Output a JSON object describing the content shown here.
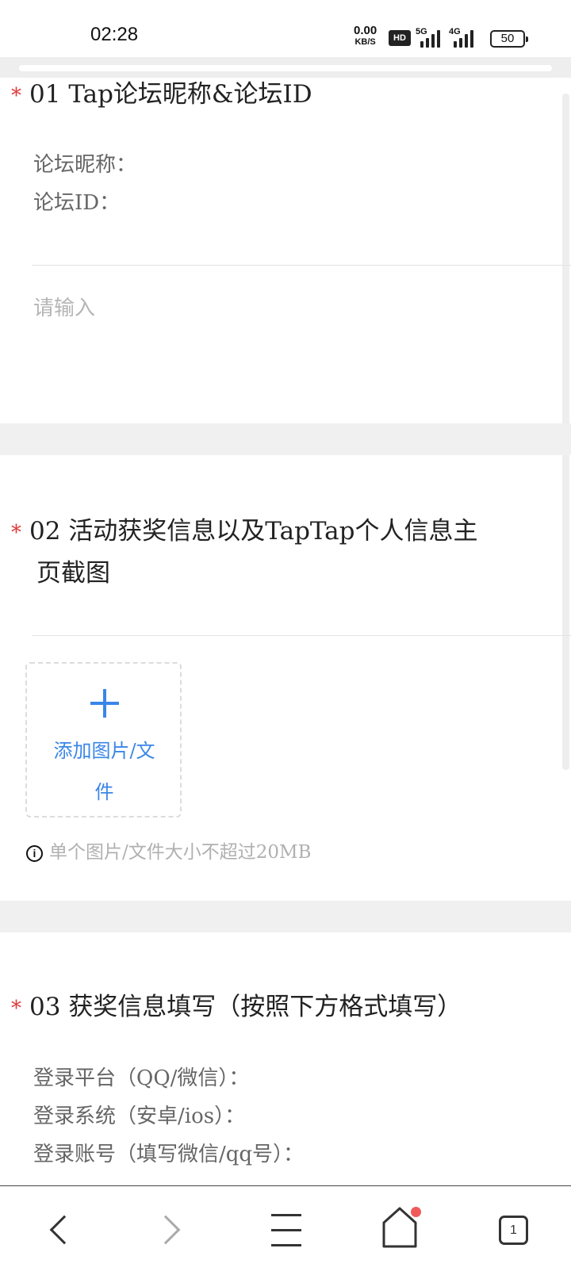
{
  "status_bar": {
    "time": "02:28",
    "net_speed_value": "0.00",
    "net_speed_unit": "KB/S",
    "hd_label": "HD",
    "signal_1_label": "5G",
    "signal_2_label": "4G",
    "battery_level": "50"
  },
  "form": {
    "q1": {
      "number": "01",
      "title": "Tap论坛昵称&论坛ID",
      "line_nickname": "论坛昵称：",
      "line_id": "论坛ID：",
      "placeholder": "请输入"
    },
    "q2": {
      "number": "02",
      "title_line1": "活动获奖信息以及TapTap个人信息主",
      "title_line2": "页截图",
      "upload_label_line1": "添加图片/文",
      "upload_label_line2": "件",
      "hint": "单个图片/文件大小不超过20MB"
    },
    "q3": {
      "number": "03",
      "title": "获奖信息填写（按照下方格式填写）",
      "line_platform": "登录平台（QQ/微信）：",
      "line_system": "登录系统（安卓/ios）：",
      "line_account": "登录账号（填写微信/qq号）："
    },
    "required_mark": "*"
  },
  "bottom_nav": {
    "tabs_count": "1"
  },
  "colors": {
    "required": "#e03a3a",
    "accent": "#3a86e8",
    "notification_dot": "#f05a5a"
  },
  "icons": [
    "back-icon",
    "forward-icon",
    "menu-icon",
    "home-icon",
    "tabs-icon",
    "plus-icon",
    "info-icon"
  ]
}
